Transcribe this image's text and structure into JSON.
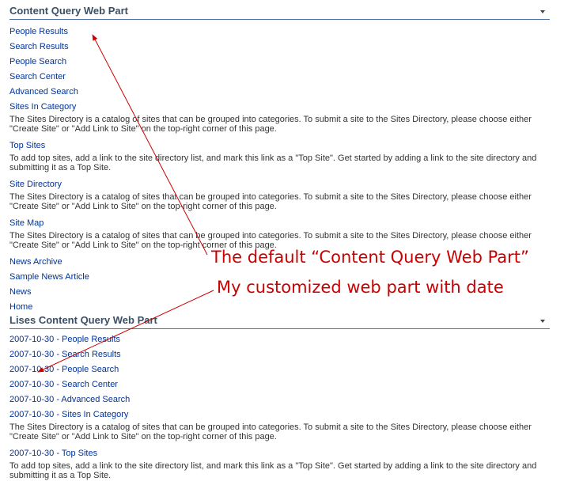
{
  "webpart1": {
    "title": "Content Query Web Part",
    "items": [
      {
        "label": "People Results"
      },
      {
        "label": "Search Results"
      },
      {
        "label": "People Search"
      },
      {
        "label": "Search Center"
      },
      {
        "label": "Advanced Search"
      },
      {
        "label": "Sites In Category",
        "desc": "The Sites Directory is a catalog of sites that can be grouped into categories. To submit a site to the Sites Directory, please choose either \"Create Site\" or \"Add Link to Site\" on the top-right corner of this page."
      },
      {
        "label": "Top Sites",
        "desc": "To add top sites, add a link to the site directory list, and mark this link as a \"Top Site\". Get started by adding a link to the site directory and submitting it as a Top Site."
      },
      {
        "label": "Site Directory",
        "desc": "The Sites Directory is a catalog of sites that can be grouped into categories. To submit a site to the Sites Directory, please choose either \"Create Site\" or \"Add Link to Site\" on the top-right corner of this page."
      },
      {
        "label": "Site Map",
        "desc": "The Sites Directory is a catalog of sites that can be grouped into categories. To submit a site to the Sites Directory, please choose either \"Create Site\" or \"Add Link to Site\" on the top-right corner of this page."
      },
      {
        "label": "News Archive"
      },
      {
        "label": "Sample News Article"
      },
      {
        "label": "News"
      },
      {
        "label": "Home"
      }
    ]
  },
  "webpart2": {
    "title": "Lises Content Query Web Part",
    "items": [
      {
        "label": "2007-10-30 - People Results"
      },
      {
        "label": "2007-10-30 - Search Results"
      },
      {
        "label": "2007-10-30 - People Search"
      },
      {
        "label": "2007-10-30 - Search Center"
      },
      {
        "label": "2007-10-30 - Advanced Search"
      },
      {
        "label": "2007-10-30 - Sites In Category",
        "desc": "The Sites Directory is a catalog of sites that can be grouped into categories. To submit a site to the Sites Directory, please choose either \"Create Site\" or \"Add Link to Site\" on the top-right corner of this page."
      },
      {
        "label": "2007-10-30 - Top Sites",
        "desc": "To add top sites, add a link to the site directory list, and mark this link as a \"Top Site\". Get started by adding a link to the site directory and submitting it as a Top Site."
      }
    ]
  },
  "annotations": {
    "default_label": "The default “Content Query Web Part”",
    "custom_label": "My customized web part with date",
    "color": "#cc0000"
  },
  "colors": {
    "link": "#003399",
    "header_text": "#3b4f65",
    "header_rule": "#4a6fa5"
  }
}
